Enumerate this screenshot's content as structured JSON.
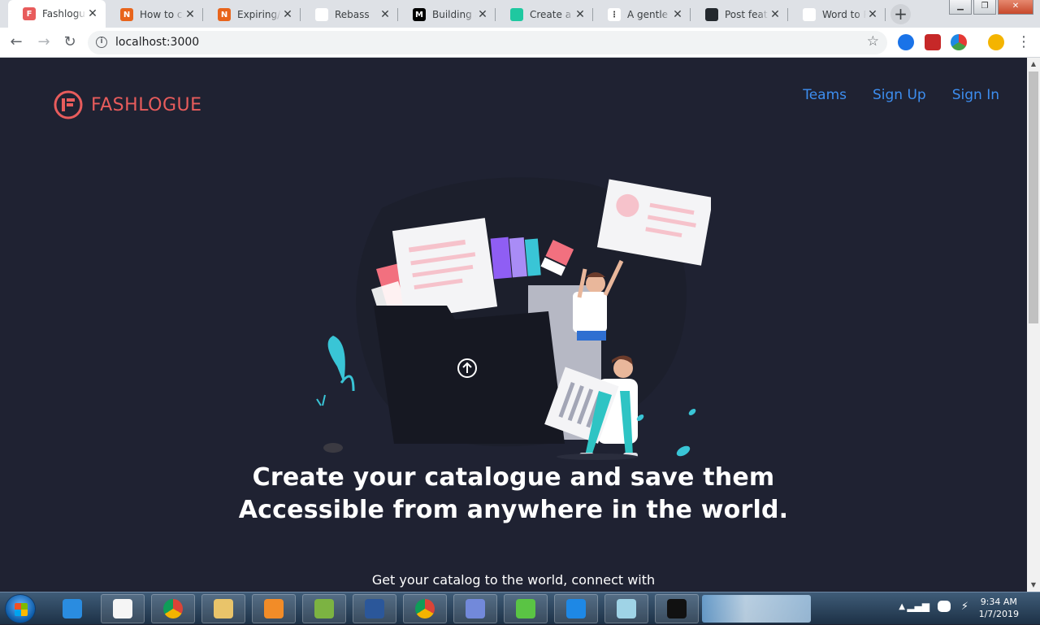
{
  "browser": {
    "tabs": [
      {
        "title": "Fashlogue",
        "fav_color": "#e85c5c",
        "fav_glyph": "F",
        "active": true
      },
      {
        "title": "How to co",
        "fav_color": "#e8641b",
        "fav_glyph": "N"
      },
      {
        "title": "Expiring/E",
        "fav_color": "#e8641b",
        "fav_glyph": "N"
      },
      {
        "title": "Rebass",
        "fav_color": "#ffffff",
        "fav_glyph": ""
      },
      {
        "title": "Building a",
        "fav_color": "#000000",
        "fav_glyph": "M"
      },
      {
        "title": "Create a p",
        "fav_color": "#1fc8a0",
        "fav_glyph": ""
      },
      {
        "title": "A gentle I",
        "fav_color": "#ffffff",
        "fav_glyph": "⋮"
      },
      {
        "title": "Post featu",
        "fav_color": "#24292e",
        "fav_glyph": ""
      },
      {
        "title": "Word to PDF C",
        "fav_color": "#ffffff",
        "fav_glyph": ""
      }
    ],
    "close_glyph": "✕",
    "new_tab_glyph": "+",
    "url": "localhost:3000"
  },
  "site": {
    "brand": "FASHLOGUE",
    "brand_color": "#e85c5c",
    "nav": [
      "Teams",
      "Sign Up",
      "Sign In"
    ],
    "nav_color": "#3d8ef0",
    "headline": "Create your catalogue and save them Accessible from anywhere in the world.",
    "subline": "Get your catalog to the world, connect with"
  },
  "taskbar": {
    "time": "9:34 AM",
    "date": "1/7/2019",
    "apps": [
      "ie-icon",
      "document-icon",
      "chrome-icon",
      "explorer-icon",
      "media-player-icon",
      "git-icon",
      "word-icon",
      "chrome-icon",
      "discord-icon",
      "wechat-icon",
      "vscode-icon",
      "notepad-icon",
      "terminal-icon"
    ]
  }
}
